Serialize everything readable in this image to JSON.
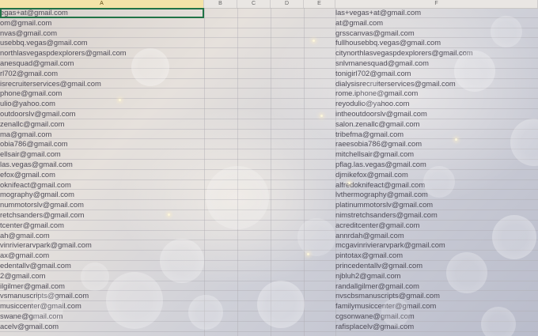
{
  "columns": {
    "a": "A",
    "b": "B",
    "c": "C",
    "d": "D",
    "e": "E",
    "f": "F"
  },
  "column_a": [
    "egas+at@gmail.com",
    "om@gmail.com",
    "nvas@gmail.com",
    "usebbq.vegas@gmail.com",
    "northlasvegaspdexplorers@gmail.com",
    "anesquad@gmail.com",
    "rl702@gmail.com",
    "isrecruiterservices@gmail.com",
    "phone@gmail.com",
    "ulio@yahoo.com",
    "outdoorslv@gmail.com",
    "zenallc@gmail.com",
    "ma@gmail.com",
    "obia786@gmail.com",
    "ellsair@gmail.com",
    "las.vegas@gmail.com",
    "efox@gmail.com",
    "oknifeact@gmail.com",
    "mography@gmail.com",
    "nummotorslv@gmail.com",
    "retchsanders@gmail.com",
    "tcenter@gmail.com",
    "ah@gmail.com",
    "vinrivierarvpark@gmail.com",
    "ax@gmail.com",
    "edentallv@gmail.com",
    "2@gmail.com",
    "ilgilmer@gmail.com",
    "vsmanuscripts@gmail.com",
    "musiccenter@gmail.com",
    "swane@gmail.com",
    "acelv@gmail.com"
  ],
  "column_f": [
    "las+vegas+at@gmail.com",
    "at@gmail.com",
    "grsscanvas@gmail.com",
    "fullhousebbq.vegas@gmail.com",
    "citynorthlasvegaspdexplorers@gmail.com",
    "snlvmanesquad@gmail.com",
    "tonigirl702@gmail.com",
    "dialysisrecruiterservices@gmail.com",
    "rome.iphone@gmail.com",
    "reyodulio@yahoo.com",
    "intheoutdoorslv@gmail.com",
    "salon.zenallc@gmail.com",
    "tribefma@gmail.com",
    "raeesobia786@gmail.com",
    "mitchellsair@gmail.com",
    "pflag.las.vegas@gmail.com",
    "djmikefox@gmail.com",
    "alfredoknifeact@gmail.com",
    "lvthermography@gmail.com",
    "platinummotorslv@gmail.com",
    "nimstretchsanders@gmail.com",
    "acreditcenter@gmail.com",
    "annrdah@gmail.com",
    "mcgavinrivierarvpark@gmail.com",
    "pintotax@gmail.com",
    "princedentallv@gmail.com",
    "njbluh2@gmail.com",
    "randallgilmer@gmail.com",
    "nvscbsmanuscripts@gmail.com",
    "familymusiccenter@gmail.com",
    "cgsonwane@gmail.com",
    "rafisplacelv@gmail.com"
  ],
  "colors": {
    "selection": "#217346",
    "column_highlight": "#f3e3a8",
    "text": "#4f4c58"
  }
}
